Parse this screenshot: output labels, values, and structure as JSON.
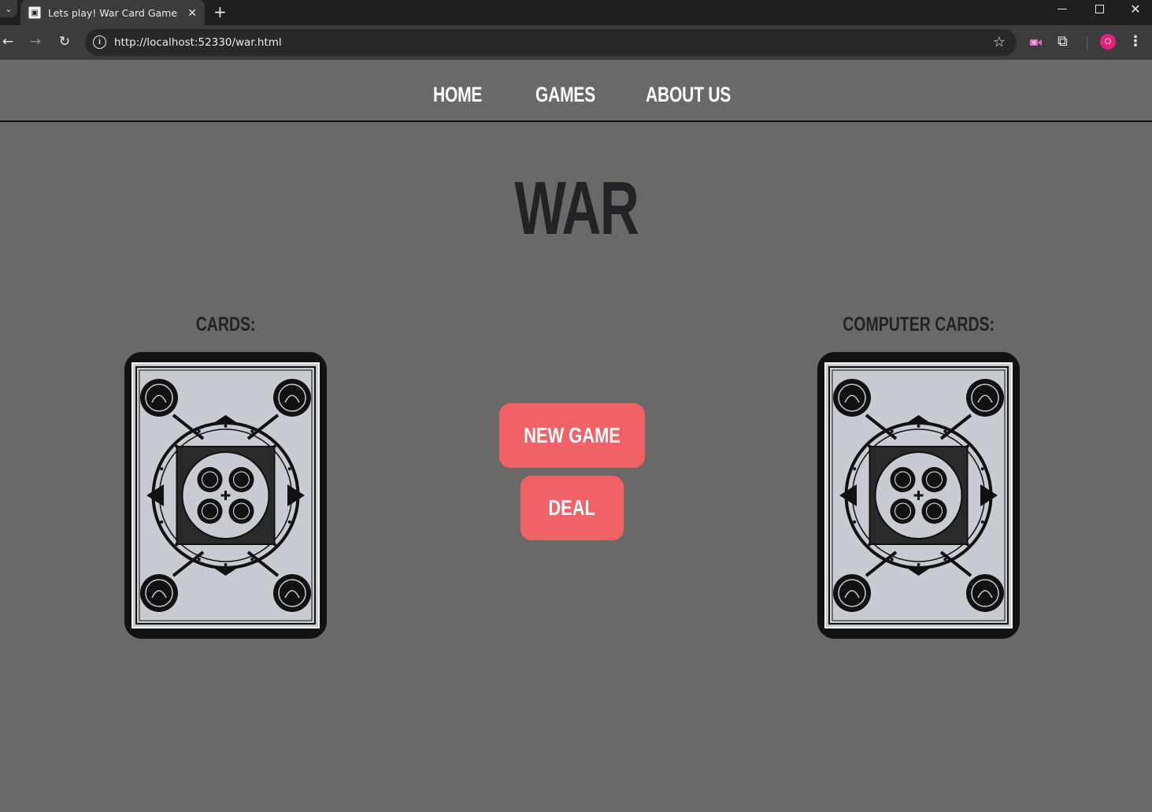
{
  "browser": {
    "tab_title": "Lets play! War Card Game",
    "tab_close": "✕",
    "new_tab": "+",
    "url": "http://localhost:52330/war.html",
    "avatar_initial": "O",
    "window_controls": {
      "minimize": "—",
      "close": "✕"
    }
  },
  "nav": {
    "home": "HOME",
    "games": "GAMES",
    "about": "ABOUT US"
  },
  "main": {
    "title": "WAR",
    "player_label": "CARDS:",
    "computer_label": "COMPUTER CARDS:",
    "new_game_button": "NEW GAME",
    "deal_button": "DEAL"
  },
  "colors": {
    "page_background": "#6a6968",
    "button_accent": "#f06265",
    "heading_dark": "#222326",
    "nav_text": "#ffffff"
  },
  "icons": {
    "back": "arrow-left-icon",
    "forward": "arrow-right-icon",
    "reload": "reload-icon",
    "site_info": "info-icon",
    "bookmark": "star-icon",
    "extensions": "puzzle-icon",
    "menu": "kebab-menu-icon"
  }
}
